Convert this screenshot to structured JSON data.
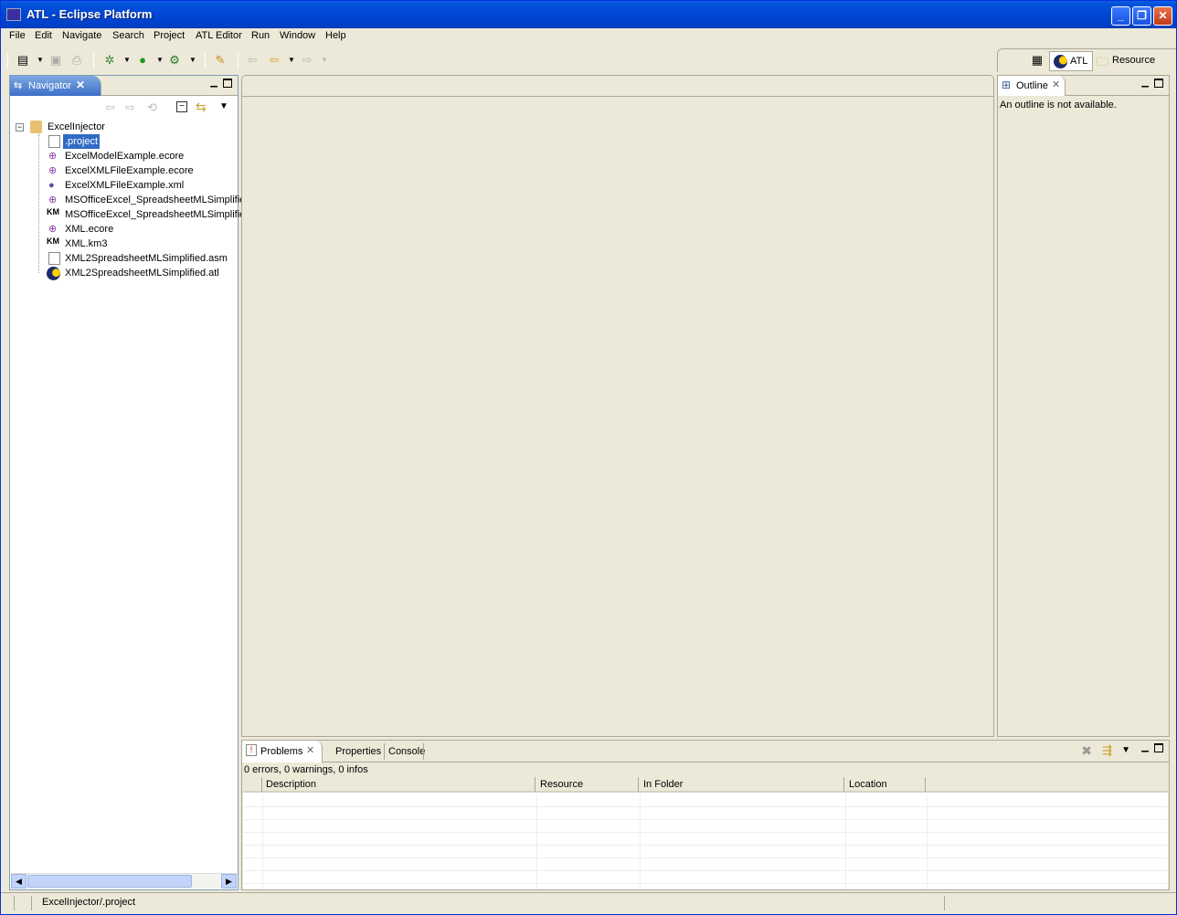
{
  "window": {
    "title": "ATL - Eclipse Platform"
  },
  "menu": [
    "File",
    "Edit",
    "Navigate",
    "Search",
    "Project",
    "ATL Editor",
    "Run",
    "Window",
    "Help"
  ],
  "perspectives": {
    "atl": "ATL",
    "resource": "Resource"
  },
  "navigator": {
    "tab_label": "Navigator",
    "project": "ExcelInjector",
    "files": [
      {
        "name": ".project",
        "icon": "text-file-icon"
      },
      {
        "name": "ExcelModelExample.ecore",
        "icon": "ecore-file-icon"
      },
      {
        "name": "ExcelXMLFileExample.ecore",
        "icon": "ecore-file-icon"
      },
      {
        "name": "ExcelXMLFileExample.xml",
        "icon": "xml-file-icon"
      },
      {
        "name": "MSOfficeExcel_SpreadsheetMLSimplifie",
        "icon": "ecore-file-icon"
      },
      {
        "name": "MSOfficeExcel_SpreadsheetMLSimplifie",
        "icon": "km3-file-icon"
      },
      {
        "name": "XML.ecore",
        "icon": "ecore-file-icon"
      },
      {
        "name": "XML.km3",
        "icon": "km3-file-icon"
      },
      {
        "name": "XML2SpreadsheetMLSimplified.asm",
        "icon": "text-file-icon"
      },
      {
        "name": "XML2SpreadsheetMLSimplified.atl",
        "icon": "atl-file-icon"
      }
    ]
  },
  "outline": {
    "tab_label": "Outline",
    "message": "An outline is not available."
  },
  "bottom": {
    "tabs": {
      "problems": "Problems",
      "properties": "Properties",
      "console": "Console"
    },
    "summary": "0 errors, 0 warnings, 0 infos",
    "columns": {
      "description": "Description",
      "resource": "Resource",
      "folder": "In Folder",
      "location": "Location"
    }
  },
  "status": {
    "text": "ExcelInjector/.project"
  },
  "colors": {
    "selection": "#316ac5",
    "titlebar": "#0046d5",
    "chrome": "#ece9d8"
  }
}
